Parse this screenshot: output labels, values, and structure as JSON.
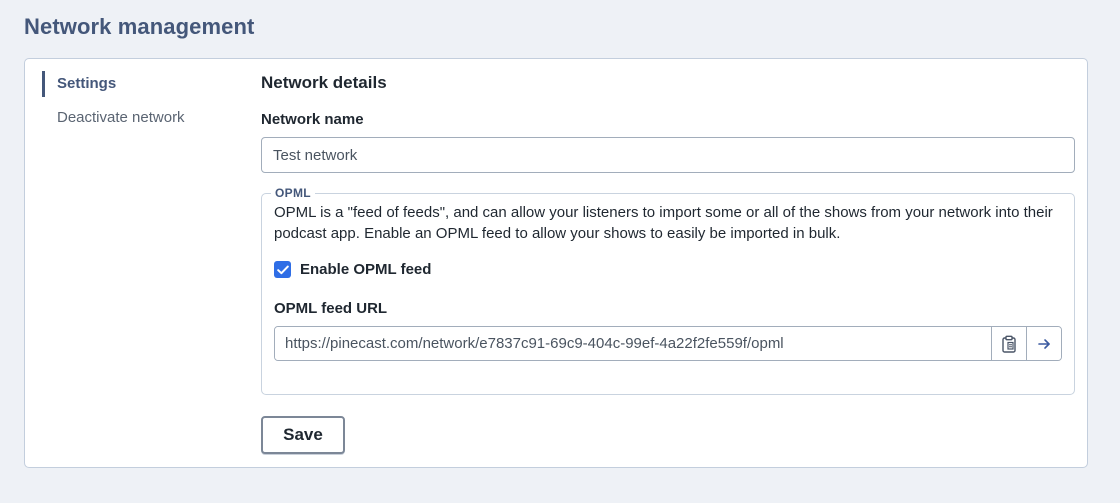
{
  "page": {
    "title": "Network management"
  },
  "sidebar": {
    "items": [
      {
        "label": "Settings",
        "active": true
      },
      {
        "label": "Deactivate network",
        "active": false
      }
    ]
  },
  "details": {
    "section_title": "Network details",
    "name_label": "Network name",
    "name_value": "Test network"
  },
  "opml": {
    "legend": "OPML",
    "description": "OPML is a \"feed of feeds\", and can allow your listeners to import some or all of the shows from your network into their podcast app. Enable an OPML feed to allow your shows to easily be imported in bulk.",
    "enable_label": "Enable OPML feed",
    "enabled": true,
    "url_label": "OPML feed URL",
    "url_value": "https://pinecast.com/network/e7837c91-69c9-404c-99ef-4a22f2fe559f/opml",
    "copy_icon": "clipboard-icon",
    "open_icon": "arrow-right-icon"
  },
  "actions": {
    "save_label": "Save"
  },
  "colors": {
    "accent": "#44577a",
    "checkbox": "#2f6ee6",
    "background": "#eef1f6"
  }
}
